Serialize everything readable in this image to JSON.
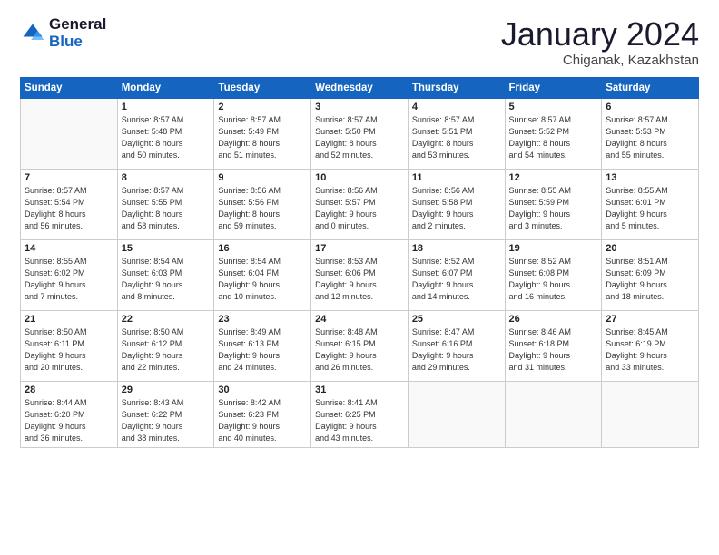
{
  "logo": {
    "general": "General",
    "blue": "Blue"
  },
  "header": {
    "title": "January 2024",
    "location": "Chiganak, Kazakhstan"
  },
  "days_of_week": [
    "Sunday",
    "Monday",
    "Tuesday",
    "Wednesday",
    "Thursday",
    "Friday",
    "Saturday"
  ],
  "weeks": [
    [
      {
        "day": "",
        "info": ""
      },
      {
        "day": "1",
        "info": "Sunrise: 8:57 AM\nSunset: 5:48 PM\nDaylight: 8 hours\nand 50 minutes."
      },
      {
        "day": "2",
        "info": "Sunrise: 8:57 AM\nSunset: 5:49 PM\nDaylight: 8 hours\nand 51 minutes."
      },
      {
        "day": "3",
        "info": "Sunrise: 8:57 AM\nSunset: 5:50 PM\nDaylight: 8 hours\nand 52 minutes."
      },
      {
        "day": "4",
        "info": "Sunrise: 8:57 AM\nSunset: 5:51 PM\nDaylight: 8 hours\nand 53 minutes."
      },
      {
        "day": "5",
        "info": "Sunrise: 8:57 AM\nSunset: 5:52 PM\nDaylight: 8 hours\nand 54 minutes."
      },
      {
        "day": "6",
        "info": "Sunrise: 8:57 AM\nSunset: 5:53 PM\nDaylight: 8 hours\nand 55 minutes."
      }
    ],
    [
      {
        "day": "7",
        "info": "Sunrise: 8:57 AM\nSunset: 5:54 PM\nDaylight: 8 hours\nand 56 minutes."
      },
      {
        "day": "8",
        "info": "Sunrise: 8:57 AM\nSunset: 5:55 PM\nDaylight: 8 hours\nand 58 minutes."
      },
      {
        "day": "9",
        "info": "Sunrise: 8:56 AM\nSunset: 5:56 PM\nDaylight: 8 hours\nand 59 minutes."
      },
      {
        "day": "10",
        "info": "Sunrise: 8:56 AM\nSunset: 5:57 PM\nDaylight: 9 hours\nand 0 minutes."
      },
      {
        "day": "11",
        "info": "Sunrise: 8:56 AM\nSunset: 5:58 PM\nDaylight: 9 hours\nand 2 minutes."
      },
      {
        "day": "12",
        "info": "Sunrise: 8:55 AM\nSunset: 5:59 PM\nDaylight: 9 hours\nand 3 minutes."
      },
      {
        "day": "13",
        "info": "Sunrise: 8:55 AM\nSunset: 6:01 PM\nDaylight: 9 hours\nand 5 minutes."
      }
    ],
    [
      {
        "day": "14",
        "info": "Sunrise: 8:55 AM\nSunset: 6:02 PM\nDaylight: 9 hours\nand 7 minutes."
      },
      {
        "day": "15",
        "info": "Sunrise: 8:54 AM\nSunset: 6:03 PM\nDaylight: 9 hours\nand 8 minutes."
      },
      {
        "day": "16",
        "info": "Sunrise: 8:54 AM\nSunset: 6:04 PM\nDaylight: 9 hours\nand 10 minutes."
      },
      {
        "day": "17",
        "info": "Sunrise: 8:53 AM\nSunset: 6:06 PM\nDaylight: 9 hours\nand 12 minutes."
      },
      {
        "day": "18",
        "info": "Sunrise: 8:52 AM\nSunset: 6:07 PM\nDaylight: 9 hours\nand 14 minutes."
      },
      {
        "day": "19",
        "info": "Sunrise: 8:52 AM\nSunset: 6:08 PM\nDaylight: 9 hours\nand 16 minutes."
      },
      {
        "day": "20",
        "info": "Sunrise: 8:51 AM\nSunset: 6:09 PM\nDaylight: 9 hours\nand 18 minutes."
      }
    ],
    [
      {
        "day": "21",
        "info": "Sunrise: 8:50 AM\nSunset: 6:11 PM\nDaylight: 9 hours\nand 20 minutes."
      },
      {
        "day": "22",
        "info": "Sunrise: 8:50 AM\nSunset: 6:12 PM\nDaylight: 9 hours\nand 22 minutes."
      },
      {
        "day": "23",
        "info": "Sunrise: 8:49 AM\nSunset: 6:13 PM\nDaylight: 9 hours\nand 24 minutes."
      },
      {
        "day": "24",
        "info": "Sunrise: 8:48 AM\nSunset: 6:15 PM\nDaylight: 9 hours\nand 26 minutes."
      },
      {
        "day": "25",
        "info": "Sunrise: 8:47 AM\nSunset: 6:16 PM\nDaylight: 9 hours\nand 29 minutes."
      },
      {
        "day": "26",
        "info": "Sunrise: 8:46 AM\nSunset: 6:18 PM\nDaylight: 9 hours\nand 31 minutes."
      },
      {
        "day": "27",
        "info": "Sunrise: 8:45 AM\nSunset: 6:19 PM\nDaylight: 9 hours\nand 33 minutes."
      }
    ],
    [
      {
        "day": "28",
        "info": "Sunrise: 8:44 AM\nSunset: 6:20 PM\nDaylight: 9 hours\nand 36 minutes."
      },
      {
        "day": "29",
        "info": "Sunrise: 8:43 AM\nSunset: 6:22 PM\nDaylight: 9 hours\nand 38 minutes."
      },
      {
        "day": "30",
        "info": "Sunrise: 8:42 AM\nSunset: 6:23 PM\nDaylight: 9 hours\nand 40 minutes."
      },
      {
        "day": "31",
        "info": "Sunrise: 8:41 AM\nSunset: 6:25 PM\nDaylight: 9 hours\nand 43 minutes."
      },
      {
        "day": "",
        "info": ""
      },
      {
        "day": "",
        "info": ""
      },
      {
        "day": "",
        "info": ""
      }
    ]
  ]
}
